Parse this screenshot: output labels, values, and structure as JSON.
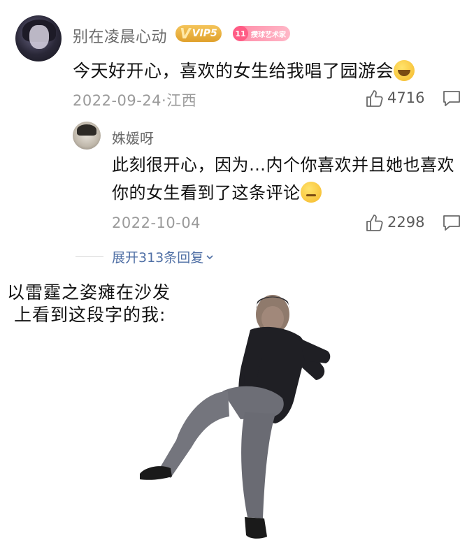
{
  "comment": {
    "username": "别在凌晨心动",
    "vip_badge": "VIP5",
    "fan_badge_level": "11",
    "fan_badge_text": "攒球艺术家",
    "text": "今天好开心，喜欢的女生给我唱了园游会",
    "emoji": "grinning-face-icon",
    "meta": "2022-09-24·江西",
    "likes": "4716"
  },
  "reply": {
    "username": "姝媛呀",
    "line1": "此刻很开心，因为…内个你喜欢并且她也喜欢",
    "line2": "你的女生看到了这条评论",
    "emoji": "thinking-face-icon",
    "meta": "2022-10-04",
    "likes": "2298"
  },
  "expand_replies": "展开313条回复",
  "meme": {
    "caption_line1": "以雷霆之姿瘫在沙发",
    "caption_line2": "上看到这段字的我:"
  },
  "colors": {
    "link": "#4f6fa5",
    "meta": "#9a9a9a",
    "vip_gold": "#e8ac35",
    "fan_pink": "#ff8aa6"
  }
}
